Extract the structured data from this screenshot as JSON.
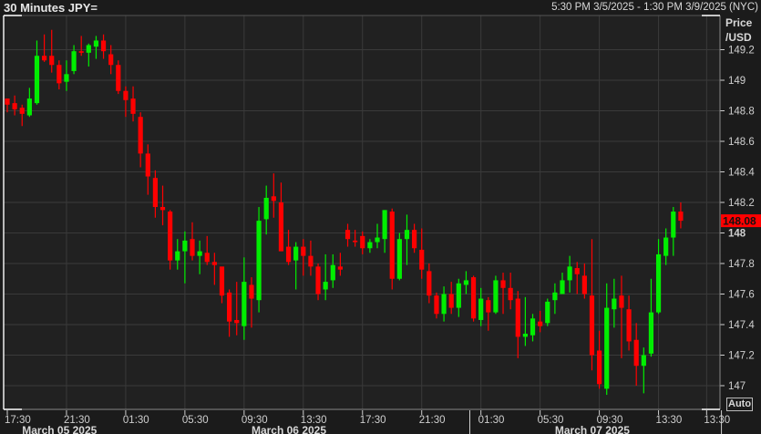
{
  "header": {
    "title": "30 Minutes JPY=",
    "range": "5:30 PM 3/5/2025 - 1:30 PM 3/9/2025 (NYC)"
  },
  "axis": {
    "title_line1": "Price",
    "title_line2": "/USD",
    "auto_label": "Auto"
  },
  "colors": {
    "up": "#00ee00",
    "down": "#ff0000",
    "grid": "#3a3a3a",
    "plot_bg": "#212121",
    "last_price_bg": "#ff0000"
  },
  "chart_data": {
    "type": "candlestick",
    "title": "30 Minutes JPY=",
    "ylabel": "Price /USD",
    "ylim": [
      146.9,
      149.4
    ],
    "yticks": [
      "149.2",
      "149",
      "148.8",
      "148.6",
      "148.4",
      "148.2",
      "148",
      "147.8",
      "147.6",
      "147.4",
      "147.2",
      "147"
    ],
    "ytick_values": [
      149.2,
      149,
      148.8,
      148.6,
      148.4,
      148.2,
      148,
      147.8,
      147.6,
      147.4,
      147.2,
      147
    ],
    "bold_ytick": "148",
    "xticks": [
      "17:30",
      "21:30",
      "01:30",
      "05:30",
      "09:30",
      "13:30",
      "17:30",
      "21:30",
      "01:30",
      "05:30",
      "09:30",
      "13:30",
      "13:30"
    ],
    "xtick_candle_index": [
      0,
      8,
      16,
      24,
      32,
      40,
      48,
      56,
      64,
      72,
      80,
      88,
      94.5
    ],
    "dates": [
      {
        "label": "March 05 2025",
        "candle_index": 2
      },
      {
        "label": "March 06 2025",
        "candle_index": 33
      },
      {
        "label": "March 07 2025",
        "candle_index": 74
      }
    ],
    "day_separator_candle_index": [
      62.5,
      96.5
    ],
    "last_price": "148.08",
    "candles_ohlc": [
      [
        148.88,
        148.88,
        148.79,
        148.84
      ],
      [
        148.85,
        148.9,
        148.77,
        148.81
      ],
      [
        148.82,
        148.84,
        148.7,
        148.78
      ],
      [
        148.77,
        148.95,
        148.76,
        148.88
      ],
      [
        148.85,
        149.26,
        148.84,
        149.16
      ],
      [
        149.16,
        149.3,
        149.12,
        149.13
      ],
      [
        149.16,
        149.33,
        149.05,
        149.1
      ],
      [
        149.1,
        149.13,
        148.94,
        148.98
      ],
      [
        148.99,
        149.13,
        148.93,
        149.04
      ],
      [
        149.06,
        149.23,
        149.04,
        149.19
      ],
      [
        149.19,
        149.29,
        149.16,
        149.18
      ],
      [
        149.18,
        149.24,
        149.09,
        149.23
      ],
      [
        149.22,
        149.29,
        149.14,
        149.26
      ],
      [
        149.26,
        149.3,
        149.14,
        149.19
      ],
      [
        149.17,
        149.23,
        149.04,
        149.1
      ],
      [
        149.1,
        149.13,
        148.91,
        148.93
      ],
      [
        148.93,
        148.96,
        148.76,
        148.87
      ],
      [
        148.88,
        148.96,
        148.73,
        148.78
      ],
      [
        148.76,
        148.79,
        148.43,
        148.52
      ],
      [
        148.52,
        148.58,
        148.25,
        148.37
      ],
      [
        148.36,
        148.41,
        148.1,
        148.17
      ],
      [
        148.17,
        148.31,
        148.05,
        148.15
      ],
      [
        148.14,
        148.15,
        147.76,
        147.82
      ],
      [
        147.82,
        147.96,
        147.76,
        147.88
      ],
      [
        147.88,
        148.01,
        147.67,
        147.95
      ],
      [
        147.96,
        148.07,
        147.82,
        147.85
      ],
      [
        147.85,
        147.95,
        147.73,
        147.88
      ],
      [
        147.87,
        147.98,
        147.79,
        147.81
      ],
      [
        147.81,
        147.87,
        147.66,
        147.79
      ],
      [
        147.78,
        147.78,
        147.54,
        147.59
      ],
      [
        147.61,
        147.63,
        147.32,
        147.42
      ],
      [
        147.43,
        147.68,
        147.33,
        147.41
      ],
      [
        147.39,
        147.84,
        147.3,
        147.68
      ],
      [
        147.66,
        147.71,
        147.38,
        147.57
      ],
      [
        147.56,
        148.17,
        147.48,
        148.08
      ],
      [
        148.09,
        148.31,
        147.99,
        148.23
      ],
      [
        148.24,
        148.39,
        148.1,
        148.21
      ],
      [
        148.2,
        148.33,
        147.88,
        147.88
      ],
      [
        147.91,
        148.02,
        147.79,
        147.81
      ],
      [
        147.82,
        147.94,
        147.63,
        147.91
      ],
      [
        147.91,
        147.96,
        147.72,
        147.85
      ],
      [
        147.85,
        147.95,
        147.72,
        147.78
      ],
      [
        147.78,
        147.8,
        147.56,
        147.6
      ],
      [
        147.63,
        147.86,
        147.56,
        147.68
      ],
      [
        147.69,
        147.86,
        147.64,
        147.79
      ],
      [
        147.78,
        147.87,
        147.72,
        147.76
      ],
      [
        148.02,
        148.06,
        147.91,
        147.96
      ],
      [
        147.95,
        148.02,
        147.91,
        147.94
      ],
      [
        147.98,
        148.01,
        147.86,
        147.9
      ],
      [
        147.9,
        147.96,
        147.87,
        147.94
      ],
      [
        147.94,
        148.06,
        147.9,
        147.97
      ],
      [
        147.96,
        148.15,
        147.87,
        148.15
      ],
      [
        148.14,
        148.16,
        147.63,
        147.7
      ],
      [
        147.7,
        148.0,
        147.69,
        147.96
      ],
      [
        147.96,
        148.12,
        147.79,
        148.02
      ],
      [
        148.02,
        148.06,
        147.87,
        147.9
      ],
      [
        147.89,
        148.03,
        147.7,
        147.76
      ],
      [
        147.75,
        147.8,
        147.54,
        147.59
      ],
      [
        147.59,
        147.61,
        147.44,
        147.47
      ],
      [
        147.47,
        147.65,
        147.42,
        147.6
      ],
      [
        147.6,
        147.68,
        147.47,
        147.51
      ],
      [
        147.51,
        147.7,
        147.45,
        147.67
      ],
      [
        147.66,
        147.75,
        147.6,
        147.69
      ],
      [
        147.71,
        147.72,
        147.42,
        147.44
      ],
      [
        147.43,
        147.64,
        147.39,
        147.57
      ],
      [
        147.56,
        147.58,
        147.36,
        147.48
      ],
      [
        147.48,
        147.72,
        147.47,
        147.69
      ],
      [
        147.69,
        147.74,
        147.47,
        147.64
      ],
      [
        147.64,
        147.74,
        147.5,
        147.56
      ],
      [
        147.57,
        147.62,
        147.18,
        147.32
      ],
      [
        147.32,
        147.58,
        147.26,
        147.34
      ],
      [
        147.33,
        147.47,
        147.29,
        147.44
      ],
      [
        147.42,
        147.49,
        147.35,
        147.39
      ],
      [
        147.41,
        147.57,
        147.39,
        147.55
      ],
      [
        147.56,
        147.67,
        147.47,
        147.61
      ],
      [
        147.6,
        147.74,
        147.6,
        147.69
      ],
      [
        147.69,
        147.85,
        147.61,
        147.78
      ],
      [
        147.77,
        147.81,
        147.6,
        147.73
      ],
      [
        147.72,
        147.8,
        147.57,
        147.6
      ],
      [
        147.59,
        147.96,
        147.1,
        147.2
      ],
      [
        147.23,
        147.36,
        146.98,
        147.01
      ],
      [
        146.98,
        147.67,
        146.94,
        147.51
      ],
      [
        147.5,
        147.7,
        147.38,
        147.57
      ],
      [
        147.59,
        147.72,
        147.18,
        147.51
      ],
      [
        147.5,
        147.59,
        147.23,
        147.29
      ],
      [
        147.3,
        147.41,
        147.0,
        147.13
      ],
      [
        147.13,
        147.25,
        146.95,
        147.2
      ],
      [
        147.21,
        147.7,
        147.19,
        147.48
      ],
      [
        147.48,
        147.96,
        147.47,
        147.86
      ],
      [
        147.85,
        148.03,
        147.79,
        147.97
      ],
      [
        147.97,
        148.17,
        147.85,
        148.14
      ],
      [
        148.14,
        148.2,
        148.03,
        148.08
      ]
    ]
  }
}
